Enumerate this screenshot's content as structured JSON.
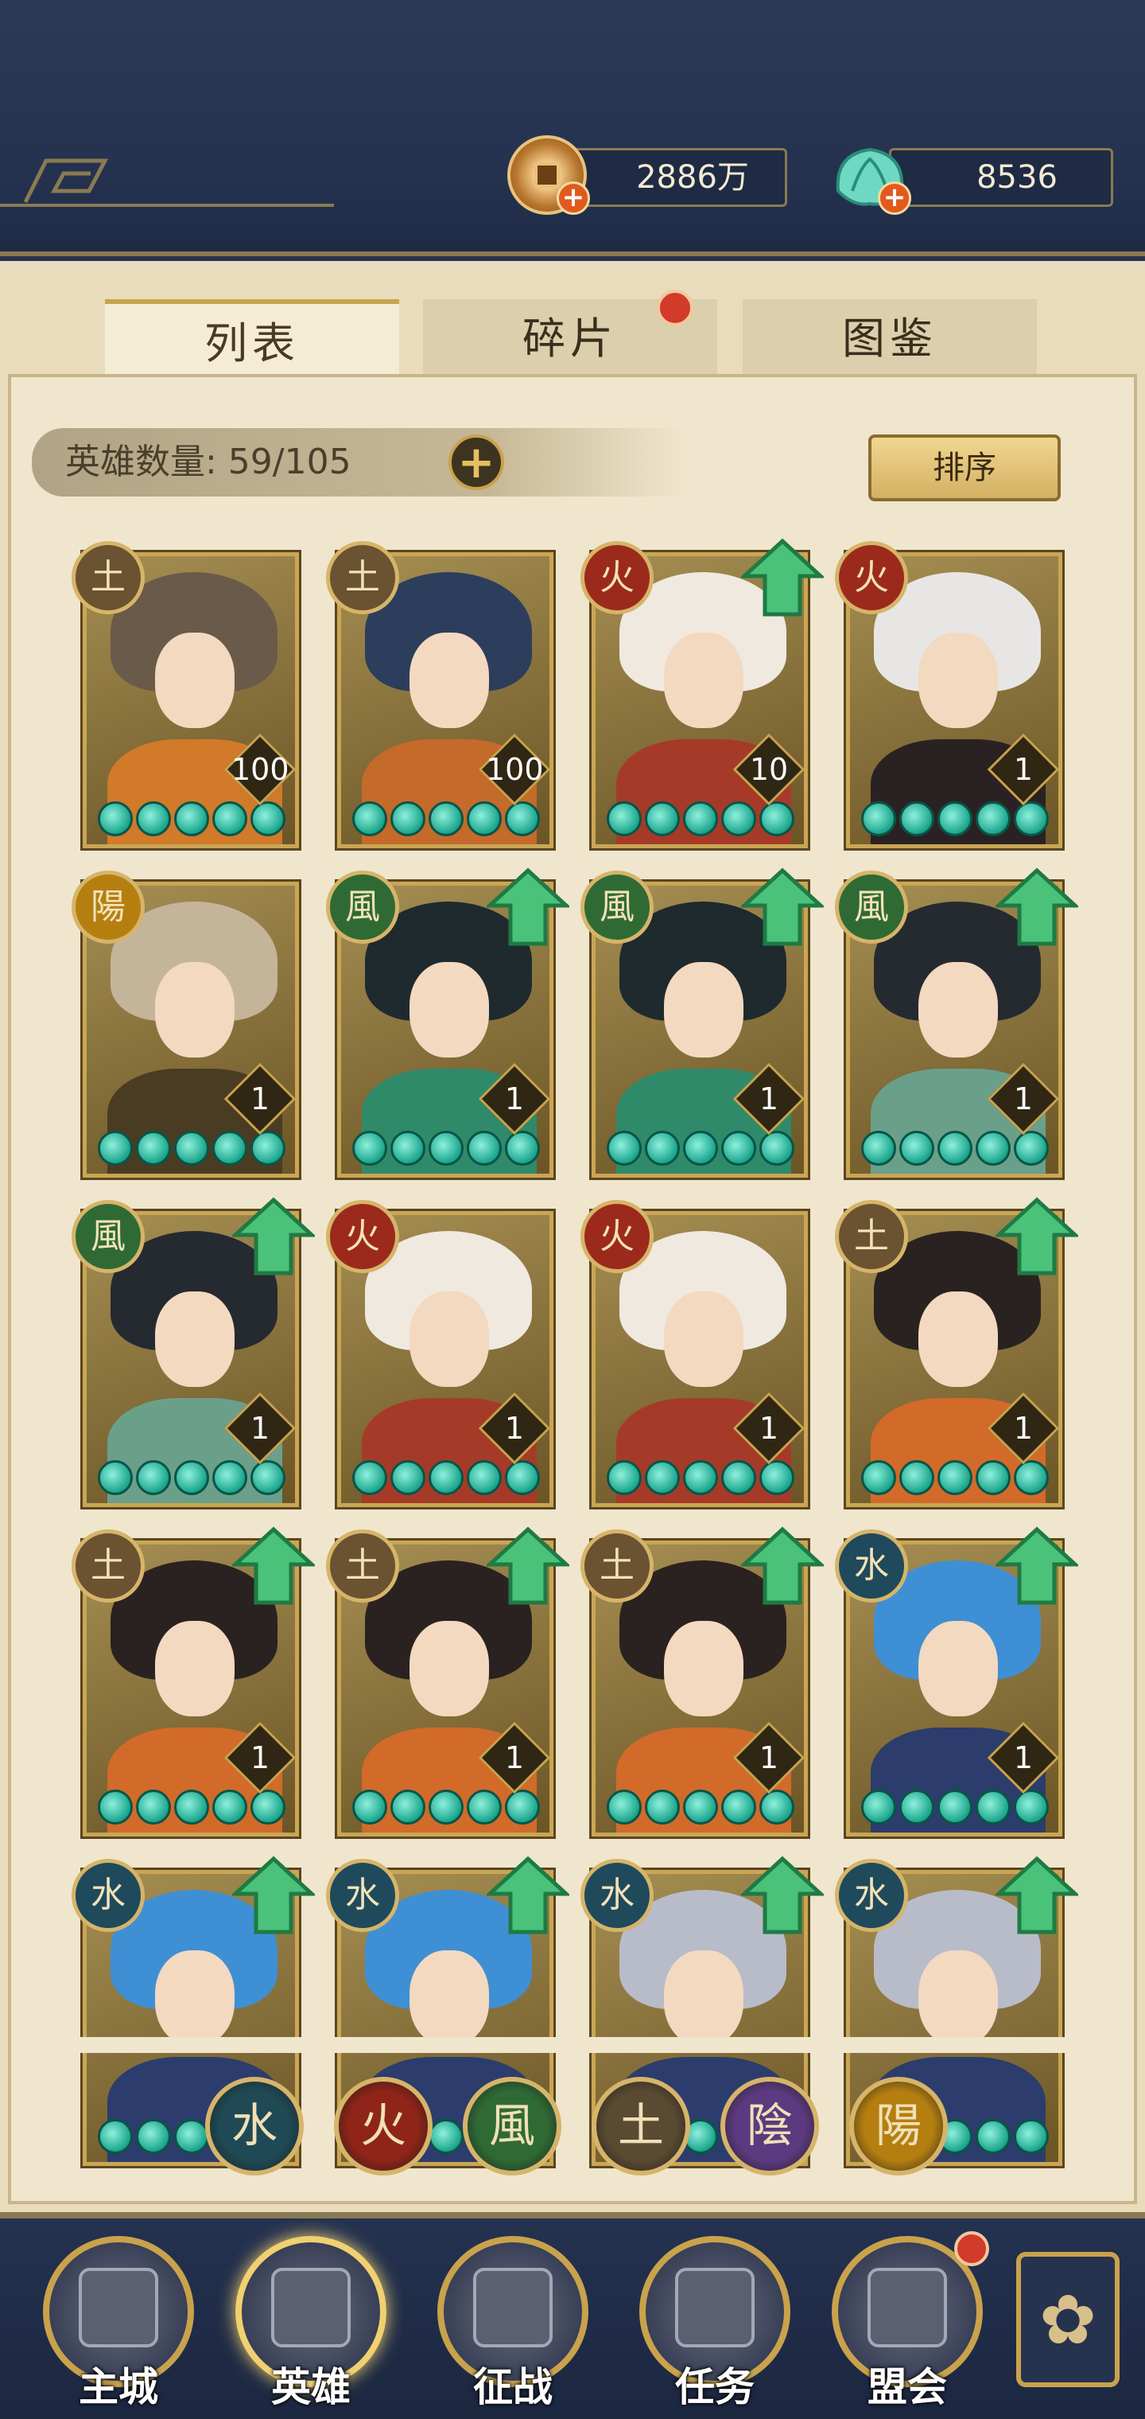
{
  "currency": {
    "coins": "2886万",
    "gems": "8536",
    "plus_symbol": "+"
  },
  "tabs": [
    {
      "label": "列表"
    },
    {
      "label": "碎片"
    },
    {
      "label": "图鉴"
    }
  ],
  "roster": {
    "count_label": "英雄数量: 59/105",
    "add_symbol": "+",
    "sort_label": "排序"
  },
  "heroes": [
    {
      "element": "土",
      "level": "100",
      "upgrade": false
    },
    {
      "element": "土",
      "level": "100",
      "upgrade": false
    },
    {
      "element": "火",
      "level": "10",
      "upgrade": true
    },
    {
      "element": "火",
      "level": "1",
      "upgrade": false
    },
    {
      "element": "陽",
      "level": "1",
      "upgrade": false
    },
    {
      "element": "風",
      "level": "1",
      "upgrade": true
    },
    {
      "element": "風",
      "level": "1",
      "upgrade": true
    },
    {
      "element": "風",
      "level": "1",
      "upgrade": true
    },
    {
      "element": "風",
      "level": "1",
      "upgrade": true
    },
    {
      "element": "火",
      "level": "1",
      "upgrade": false
    },
    {
      "element": "火",
      "level": "1",
      "upgrade": false
    },
    {
      "element": "土",
      "level": "1",
      "upgrade": true
    },
    {
      "element": "土",
      "level": "1",
      "upgrade": true
    },
    {
      "element": "土",
      "level": "1",
      "upgrade": true
    },
    {
      "element": "土",
      "level": "1",
      "upgrade": true
    },
    {
      "element": "水",
      "level": "1",
      "upgrade": true
    },
    {
      "element": "水",
      "level": "",
      "upgrade": true
    },
    {
      "element": "水",
      "level": "",
      "upgrade": true
    },
    {
      "element": "水",
      "level": "",
      "upgrade": true
    },
    {
      "element": "水",
      "level": "",
      "upgrade": true
    }
  ],
  "filters": [
    {
      "glyph": "水",
      "color": "#1f4a55"
    },
    {
      "glyph": "火",
      "color": "#8f2418"
    },
    {
      "glyph": "風",
      "color": "#2f6a35"
    },
    {
      "glyph": "土",
      "color": "#5a4a32"
    },
    {
      "glyph": "陰",
      "color": "#5d3a80"
    },
    {
      "glyph": "陽",
      "color": "#b57f10"
    }
  ],
  "nav": [
    {
      "label": "主城",
      "icon": "city-gate-icon"
    },
    {
      "label": "英雄",
      "icon": "hero-portrait-icon"
    },
    {
      "label": "征战",
      "icon": "battle-helmet-icon"
    },
    {
      "label": "任务",
      "icon": "quest-scroll-icon"
    },
    {
      "label": "盟会",
      "icon": "guild-gate-icon"
    }
  ],
  "colors": {
    "element_earth": "#6b5230",
    "element_fire": "#9c2a1c",
    "element_wind": "#2f6a35",
    "element_water": "#1f4a5c",
    "element_yang": "#b57f10"
  }
}
